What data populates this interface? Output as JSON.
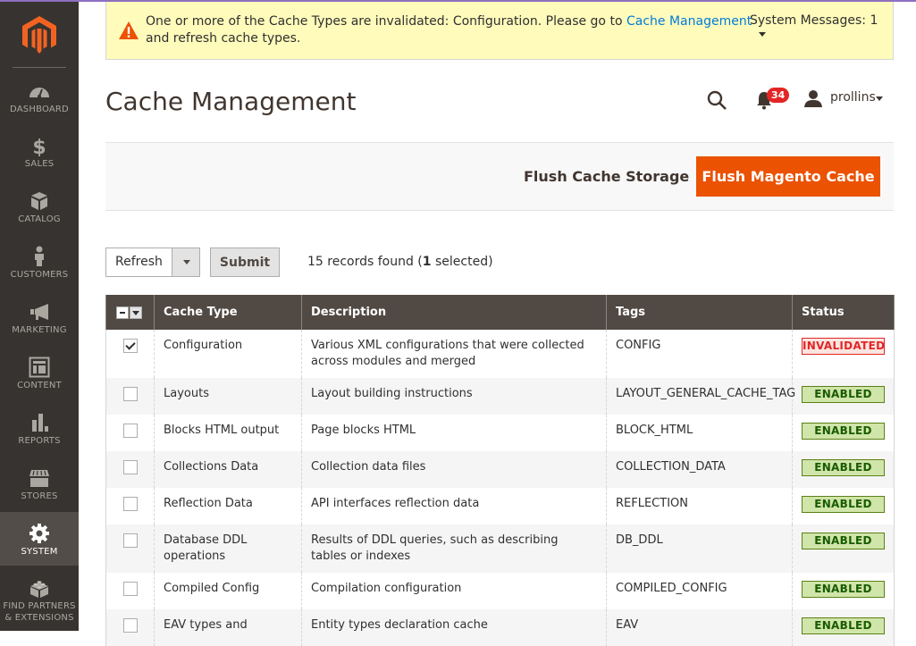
{
  "sidebar": {
    "items": [
      {
        "label": "DASHBOARD",
        "icon": "dashboard-icon"
      },
      {
        "label": "SALES",
        "icon": "dollar-icon"
      },
      {
        "label": "CATALOG",
        "icon": "box-icon"
      },
      {
        "label": "CUSTOMERS",
        "icon": "person-icon"
      },
      {
        "label": "MARKETING",
        "icon": "megaphone-icon"
      },
      {
        "label": "CONTENT",
        "icon": "layout-icon"
      },
      {
        "label": "REPORTS",
        "icon": "bar-chart-icon"
      },
      {
        "label": "STORES",
        "icon": "storefront-icon"
      },
      {
        "label": "SYSTEM",
        "icon": "gear-icon",
        "active": true
      },
      {
        "label_line1": "FIND PARTNERS",
        "label_line2": "& EXTENSIONS",
        "icon": "lego-brick-icon"
      }
    ]
  },
  "system_message": {
    "text_before": "One or more of the Cache Types are invalidated: Configuration. Please go to ",
    "link_text": "Cache Management",
    "text_after": " and refresh cache types.",
    "counter_label": "System Messages: 1"
  },
  "header": {
    "title": "Cache Management",
    "notification_count": "34",
    "username": "prollins"
  },
  "actions": {
    "flush_storage": "Flush Cache Storage",
    "flush_magento": "Flush Magento Cache"
  },
  "mass_action": {
    "selected": "Refresh",
    "submit": "Submit",
    "records_prefix": "15 records found (",
    "selected_count": "1",
    "records_suffix": " selected)"
  },
  "colors": {
    "accent": "#eb5202",
    "sidebar_bg": "#373330",
    "table_header_bg": "#514943",
    "enabled_bg": "#d0e5a9",
    "invalidated_text": "#e22626"
  },
  "table": {
    "columns": [
      "Cache Type",
      "Description",
      "Tags",
      "Status"
    ],
    "rows": [
      {
        "checked": true,
        "type": "Configuration",
        "description": "Various XML configurations that were collected across modules and merged",
        "tags": "CONFIG",
        "status": "INVALIDATED"
      },
      {
        "checked": false,
        "type": "Layouts",
        "description": "Layout building instructions",
        "tags": "LAYOUT_GENERAL_CACHE_TAG",
        "status": "ENABLED"
      },
      {
        "checked": false,
        "type": "Blocks HTML output",
        "description": "Page blocks HTML",
        "tags": "BLOCK_HTML",
        "status": "ENABLED"
      },
      {
        "checked": false,
        "type": "Collections Data",
        "description": "Collection data files",
        "tags": "COLLECTION_DATA",
        "status": "ENABLED"
      },
      {
        "checked": false,
        "type": "Reflection Data",
        "description": "API interfaces reflection data",
        "tags": "REFLECTION",
        "status": "ENABLED"
      },
      {
        "checked": false,
        "type": "Database DDL operations",
        "description": "Results of DDL queries, such as describing tables or indexes",
        "tags": "DB_DDL",
        "status": "ENABLED"
      },
      {
        "checked": false,
        "type": "Compiled Config",
        "description": "Compilation configuration",
        "tags": "COMPILED_CONFIG",
        "status": "ENABLED"
      },
      {
        "checked": false,
        "type": "EAV types and",
        "description": "Entity types declaration cache",
        "tags": "EAV",
        "status": "ENABLED"
      }
    ]
  }
}
